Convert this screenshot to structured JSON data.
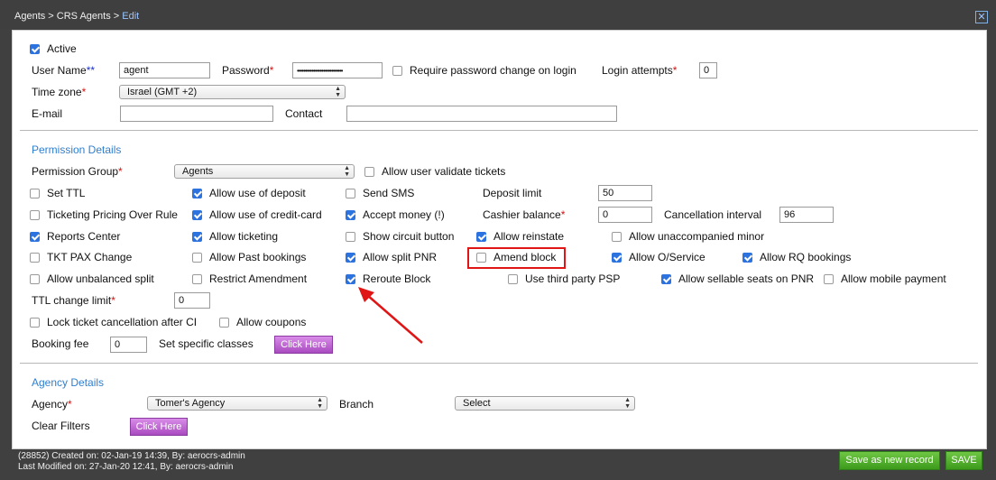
{
  "breadcrumb": {
    "agents": "Agents",
    "sep1": " > ",
    "crs_agents": "CRS Agents",
    "sep2": " > ",
    "current": "Edit"
  },
  "close_icon": "close-icon",
  "form": {
    "active": "Active",
    "user_name_label": "User Name",
    "user_name_req": "**",
    "user_name_value": "agent",
    "password_label": "Password",
    "password_value": "••••••••••••••••••••••••••••",
    "require_pw_label": "Require password change on login",
    "login_attempts_label": "Login attempts",
    "login_attempts_value": "0",
    "timezone_label": "Time zone",
    "timezone_value": "Israel (GMT +2)",
    "email_label": "E-mail",
    "contact_label": "Contact",
    "req_star": "*"
  },
  "permission": {
    "title": "Permission Details",
    "group_label": "Permission Group",
    "group_value": "Agents",
    "allow_validate": "Allow user validate tickets",
    "set_ttl": "Set TTL",
    "ticketing_pricing": "Ticketing Pricing Over Rule",
    "reports_center": "Reports Center",
    "tkt_pax": "TKT PAX Change",
    "allow_unbalanced": "Allow unbalanced split",
    "ttl_change_limit": "TTL change limit",
    "ttl_change_value": "0",
    "lock_ticket": "Lock ticket cancellation after CI",
    "allow_coupons": "Allow coupons",
    "booking_fee": "Booking fee",
    "booking_fee_value": "0",
    "set_specific_classes": "Set specific classes",
    "click_here": "Click Here",
    "allow_deposit": "Allow use of deposit",
    "allow_credit": "Allow use of credit-card",
    "allow_ticketing": "Allow ticketing",
    "allow_past": "Allow Past bookings",
    "restrict_amend": "Restrict Amendment",
    "send_sms": "Send SMS",
    "accept_money": "Accept money (!)",
    "show_circuit": "Show circuit button",
    "allow_split_pnr": "Allow split PNR",
    "reroute_block": "Reroute Block",
    "deposit_limit": "Deposit limit",
    "deposit_limit_value": "50",
    "cashier_balance": "Cashier balance",
    "cashier_balance_value": "0",
    "allow_reinstate": "Allow reinstate",
    "amend_block": "Amend block",
    "use_third_party": "Use third party PSP",
    "cancellation_interval": "Cancellation interval",
    "cancellation_interval_value": "96",
    "allow_unaccompanied": "Allow unaccompanied minor",
    "allow_oservice": "Allow O/Service",
    "allow_rq": "Allow RQ bookings",
    "allow_sellable": "Allow sellable seats on PNR",
    "allow_mobile": "Allow mobile payment"
  },
  "agency": {
    "title": "Agency Details",
    "agency_label": "Agency",
    "agency_value": "Tomer's Agency",
    "branch_label": "Branch",
    "branch_value": "Select",
    "clear_filters": "Clear Filters",
    "click_here": "Click Here"
  },
  "footer": {
    "created": "(28852) Created on: 02-Jan-19 14:39, By: aerocrs-admin",
    "modified": "Last Modified on: 27-Jan-20 12:41, By: aerocrs-admin",
    "save_new": "Save as new record",
    "save": "SAVE"
  },
  "colors": {
    "accent": "#2d73e0",
    "section_title": "#2f7fcf",
    "highlight": "#e01515",
    "save_green": "#3c9a1b",
    "click_purple": "#a94bc0"
  }
}
